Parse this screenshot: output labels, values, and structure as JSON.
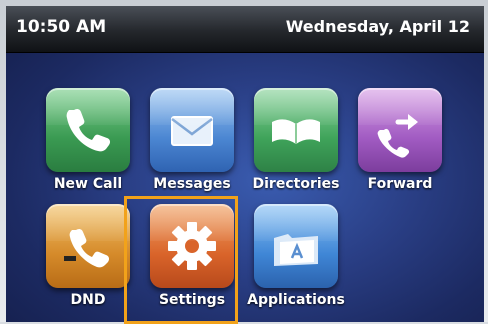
{
  "statusbar": {
    "time": "10:50 AM",
    "date": "Wednesday, April 12"
  },
  "apps": [
    {
      "label": "New Call",
      "icon": "phone-icon",
      "color": "#3a9a52"
    },
    {
      "label": "Messages",
      "icon": "envelope-icon",
      "color": "#4b86d2"
    },
    {
      "label": "Directories",
      "icon": "open-book-icon",
      "color": "#3fa35a"
    },
    {
      "label": "Forward",
      "icon": "forward-call-icon",
      "color": "#a15bc2"
    },
    {
      "label": "DND",
      "icon": "do-not-disturb-icon",
      "color": "#d58a2a"
    },
    {
      "label": "Settings",
      "icon": "gear-icon",
      "color": "#d9642a"
    },
    {
      "label": "Applications",
      "icon": "applications-folder-icon",
      "color": "#3f86d6"
    }
  ],
  "highlight_color": "#f2a21a"
}
